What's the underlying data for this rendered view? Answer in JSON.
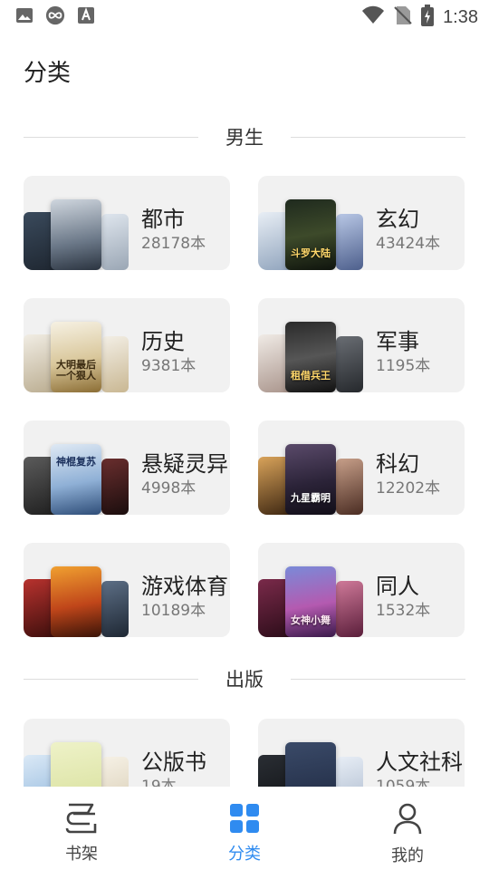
{
  "status_bar": {
    "time": "1:38"
  },
  "page_title": "分类",
  "sections": [
    {
      "label": "男生",
      "cards": [
        {
          "name": "都市",
          "count": "28178本"
        },
        {
          "name": "玄幻",
          "count": "43424本",
          "cover_text": "斗罗大陆"
        },
        {
          "name": "历史",
          "count": "9381本",
          "cover_text": "大明最后一个狠人"
        },
        {
          "name": "军事",
          "count": "1195本",
          "cover_text": "租借兵王"
        },
        {
          "name": "悬疑灵异",
          "count": "4998本",
          "cover_text": "神棍复苏"
        },
        {
          "name": "科幻",
          "count": "12202本",
          "cover_text": "九星霸明"
        },
        {
          "name": "游戏体育",
          "count": "10189本"
        },
        {
          "name": "同人",
          "count": "1532本",
          "cover_text": "女神小舞"
        }
      ]
    },
    {
      "label": "出版",
      "cards": [
        {
          "name": "公版书",
          "count": "19本"
        },
        {
          "name": "人文社科",
          "count": "1059本"
        }
      ]
    }
  ],
  "bottom_nav": [
    {
      "label": "书架",
      "icon": "bookshelf-icon",
      "active": false
    },
    {
      "label": "分类",
      "icon": "category-grid-icon",
      "active": true
    },
    {
      "label": "我的",
      "icon": "profile-icon",
      "active": false
    }
  ],
  "colors": {
    "accent": "#2f8bf0",
    "card_bg": "#f1f1f1"
  }
}
